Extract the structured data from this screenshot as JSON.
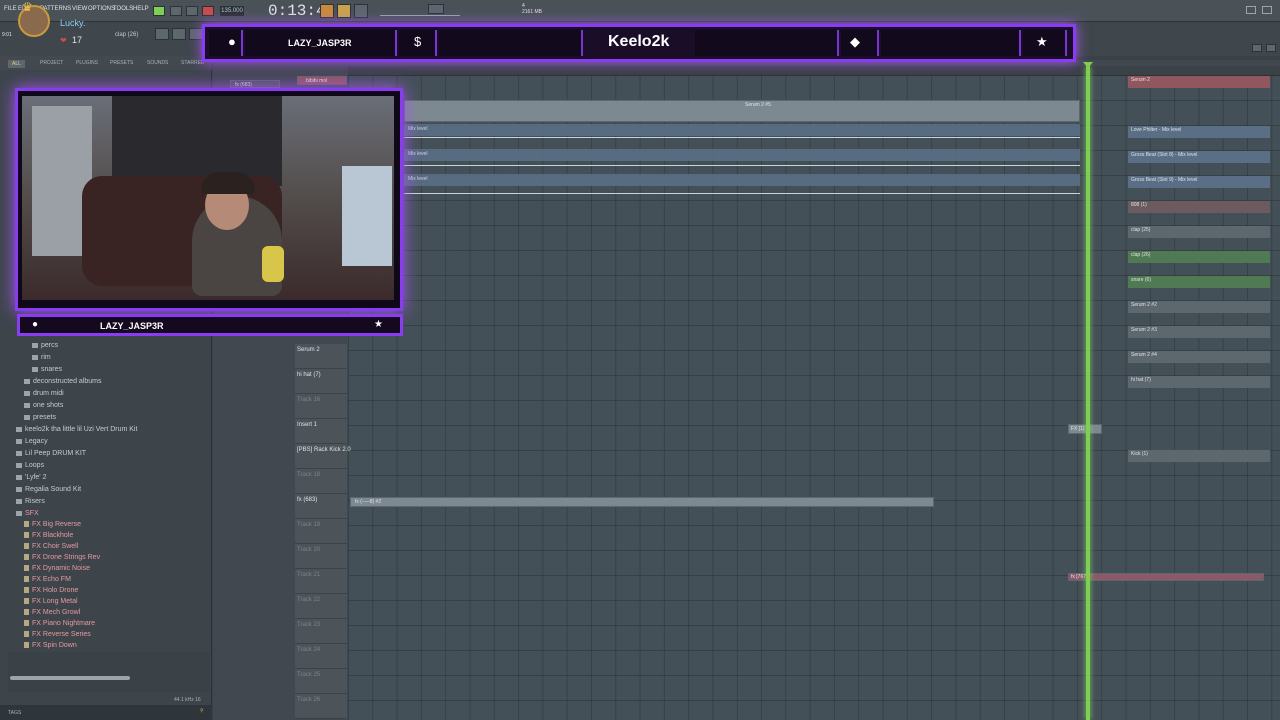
{
  "menu": {
    "items": [
      "FILE",
      "EDIT",
      "PATTERNS",
      "VIEW",
      "OPTIONS",
      "TOOLS",
      "HELP"
    ],
    "clock": "9:01",
    "hint": "clap (26)"
  },
  "topbar": {
    "tempo": "135.000",
    "time": "0:13:49",
    "cpu_mem": "2161 MB",
    "cpu_val": "4"
  },
  "user_badge": {
    "name": "Lucky.",
    "count": "17"
  },
  "browser": {
    "tabs": [
      "ALL",
      "PROJECT",
      "PLUGINS",
      "PRESETS",
      "SOUNDS",
      "STARRED"
    ],
    "active_tab": "ALL",
    "tree": [
      "percs",
      "rim",
      "snares",
      "deconstructed albums",
      "drum midi",
      "one shots",
      "presets",
      "keelo2k tha little lil Uzi Vert Drum Kit",
      "Legacy",
      "Lil Peep DRUM KIT",
      "Loops",
      "'Lyfe' 2",
      "Regalia Sound Kit",
      "Risers",
      "SFX"
    ],
    "sfx_files": [
      "FX Big Reverse",
      "FX Blackhole",
      "FX Choir Swell",
      "FX Drone Strings Rev",
      "FX Dynamic Noise",
      "FX Echo FM",
      "FX Holo Drone",
      "FX Long Metal",
      "FX Mech Growl",
      "FX Piano Nightmare",
      "FX Reverse Series",
      "FX Spin Down"
    ],
    "preview_info": "44.1 kHz 16",
    "status": "TAGS"
  },
  "overlay": {
    "username": "LAZY_JASP3R",
    "channel": "Keelo2k",
    "cam_username": "LAZY_JASP3R"
  },
  "tracks": {
    "labels": [
      "Serum 2",
      "hi hat (7)",
      "Track 16",
      "Insert 1",
      "[PBS] Rack Kick 2.0",
      "Track 18",
      "fx (683)",
      "Track 19",
      "Track 20",
      "Track 21",
      "Track 22",
      "Track 23",
      "Track 24",
      "Track 25",
      "Track 26"
    ],
    "top_clip": "bibibi mol",
    "top_fx": "fx (683)"
  },
  "clips": {
    "serum_clip": "Serum 2 #5",
    "mix_level_1": "Mix level",
    "mix_level_2": "Mix level",
    "fx_clip": "fx (–—8) #2",
    "fx_right": "FX [1]",
    "fx_right2": "fx [767]"
  },
  "minis": [
    "Serum 2",
    "Love Philter - Mix level",
    "Gross Beat (Slot 8) - Mix level",
    "Gross Beat (Slot 9) - Mix level",
    "808 (1)",
    "clap (25)",
    "clap (26)",
    "snare (6)",
    "Serum 2 #2",
    "Serum 2 #3",
    "Serum 2 #4",
    "hi hat (7)",
    "Kick (1)"
  ]
}
